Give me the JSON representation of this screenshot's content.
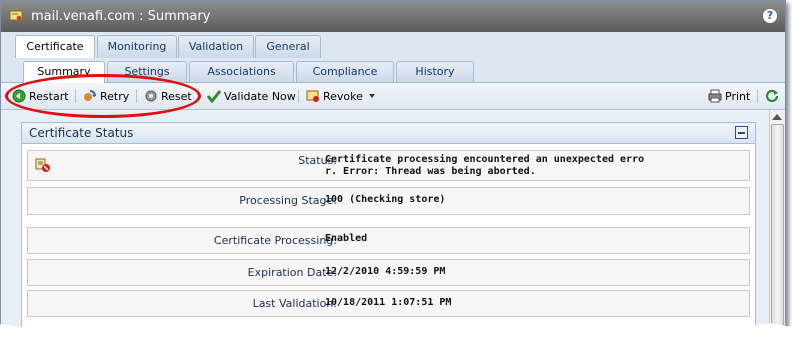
{
  "window": {
    "title": "mail.venafi.com : Summary",
    "help": "?"
  },
  "tabs": [
    "Certificate",
    "Monitoring",
    "Validation",
    "General"
  ],
  "subtabs": [
    "Summary",
    "Settings",
    "Associations",
    "Compliance",
    "History"
  ],
  "toolbar": {
    "restart": "Restart",
    "retry": "Retry",
    "reset": "Reset",
    "validate_now": "Validate Now",
    "revoke": "Revoke",
    "print": "Print"
  },
  "panel": {
    "title": "Certificate Status"
  },
  "fields": [
    {
      "label": "Status:",
      "value_line1": "Certificate processing encountered an unexpected erro",
      "value_line2": "r. Error: Thread was being aborted."
    },
    {
      "label": "Processing Stage:",
      "value": "100 (Checking store)"
    },
    {
      "label": "Certificate Processing:",
      "value": "Enabled"
    },
    {
      "label": "Expiration Date:",
      "value": "12/2/2010 4:59:59 PM"
    },
    {
      "label": "Last Validation:",
      "value": "10/18/2011 1:07:51 PM"
    }
  ],
  "colors": {
    "annotation": "#e01010",
    "accent": "#1a2f55"
  },
  "icons": [
    "certificate-icon",
    "help-icon",
    "restart-icon",
    "retry-icon",
    "reset-icon",
    "checkmark-icon",
    "revoke-icon",
    "dropdown-arrow-icon",
    "printer-icon",
    "refresh-icon",
    "certificate-error-icon",
    "collapse-icon"
  ]
}
